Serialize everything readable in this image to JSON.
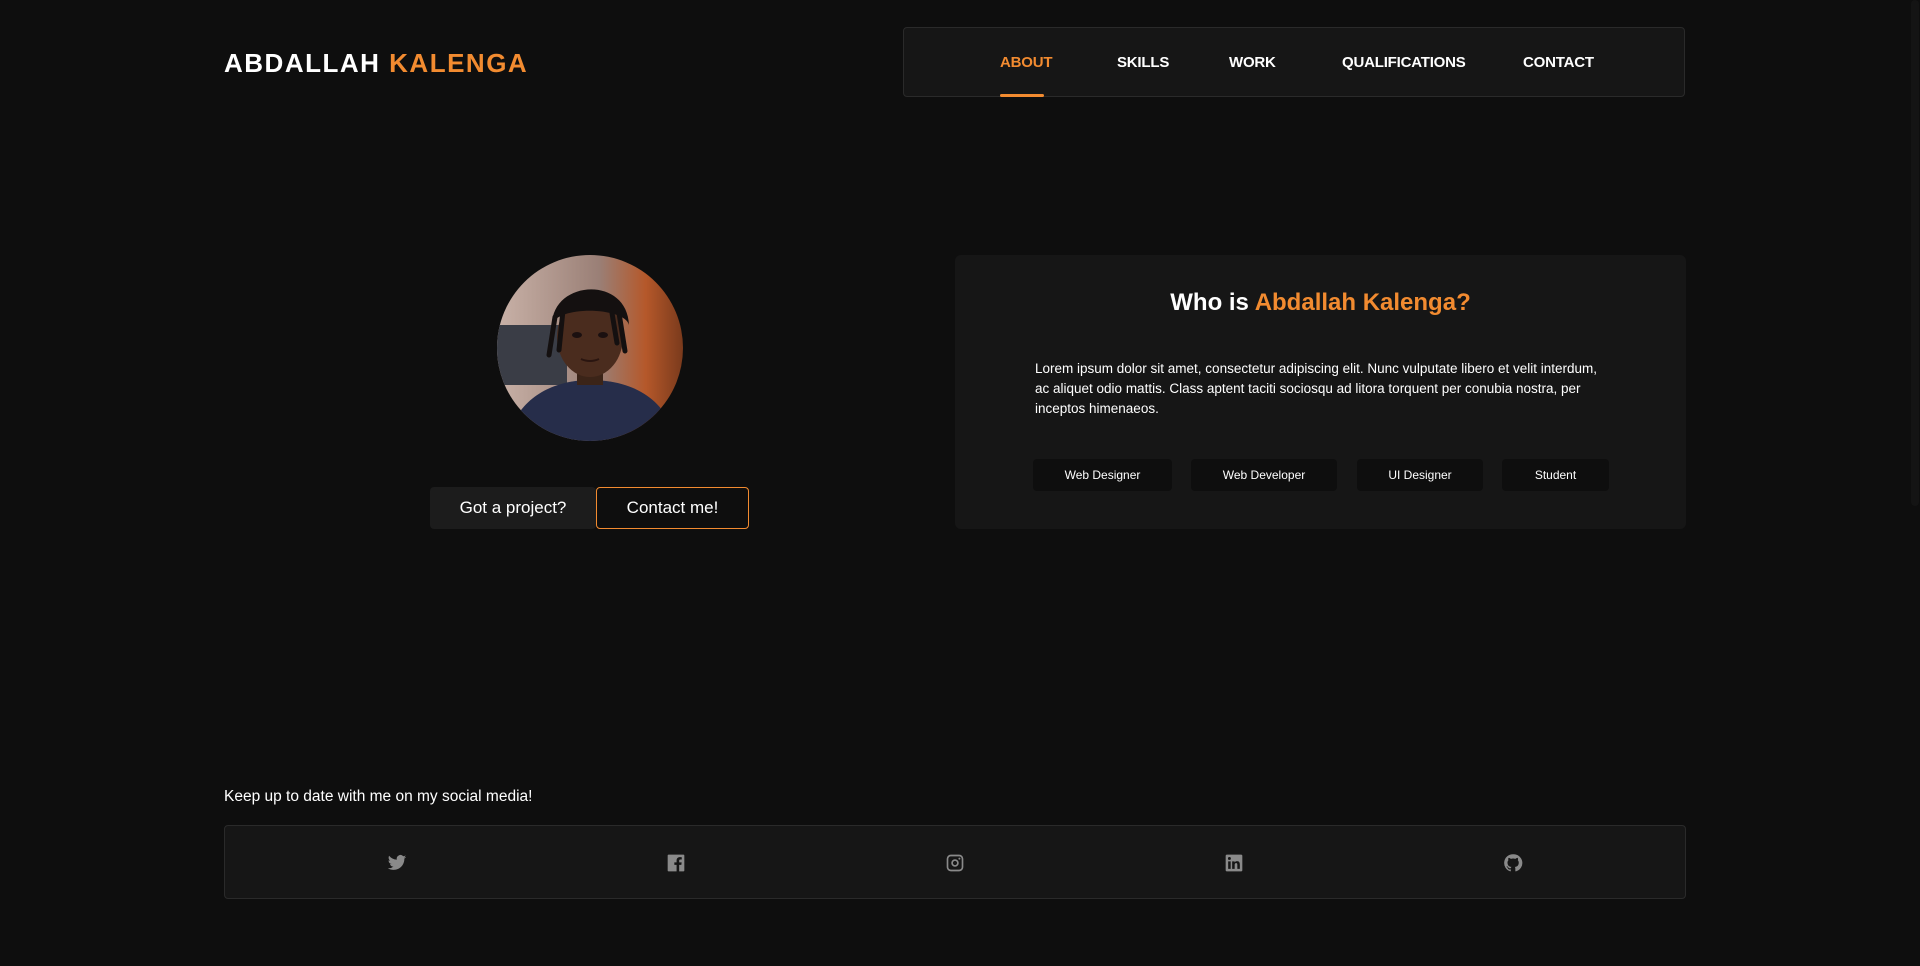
{
  "logo": {
    "first": "ABDALLAH",
    "last": "KALENGA"
  },
  "nav": {
    "items": [
      {
        "label": "ABOUT",
        "active": true
      },
      {
        "label": "SKILLS",
        "active": false
      },
      {
        "label": "WORK",
        "active": false
      },
      {
        "label": "QUALIFICATIONS",
        "active": false
      },
      {
        "label": "CONTACT",
        "active": false
      }
    ]
  },
  "hero": {
    "project_label": "Got a project?",
    "contact_label": "Contact me!"
  },
  "about": {
    "title_prefix": "Who is",
    "title_name": "Abdallah Kalenga?",
    "text": "Lorem ipsum dolor sit amet, consectetur adipiscing elit. Nunc vulputate libero et velit interdum, ac aliquet odio mattis. Class aptent taciti sociosqu ad litora torquent per conubia nostra, per inceptos himenaeos.",
    "tags": [
      "Web Designer",
      "Web Developer",
      "UI Designer",
      "Student"
    ]
  },
  "social": {
    "heading": "Keep up to date with me on my social media!",
    "icons": [
      "twitter-icon",
      "facebook-icon",
      "instagram-icon",
      "linkedin-icon",
      "github-icon"
    ]
  },
  "colors": {
    "accent": "#f28b30",
    "background": "#0e0e0e",
    "card": "#161616",
    "icon": "#8a8a8a"
  }
}
